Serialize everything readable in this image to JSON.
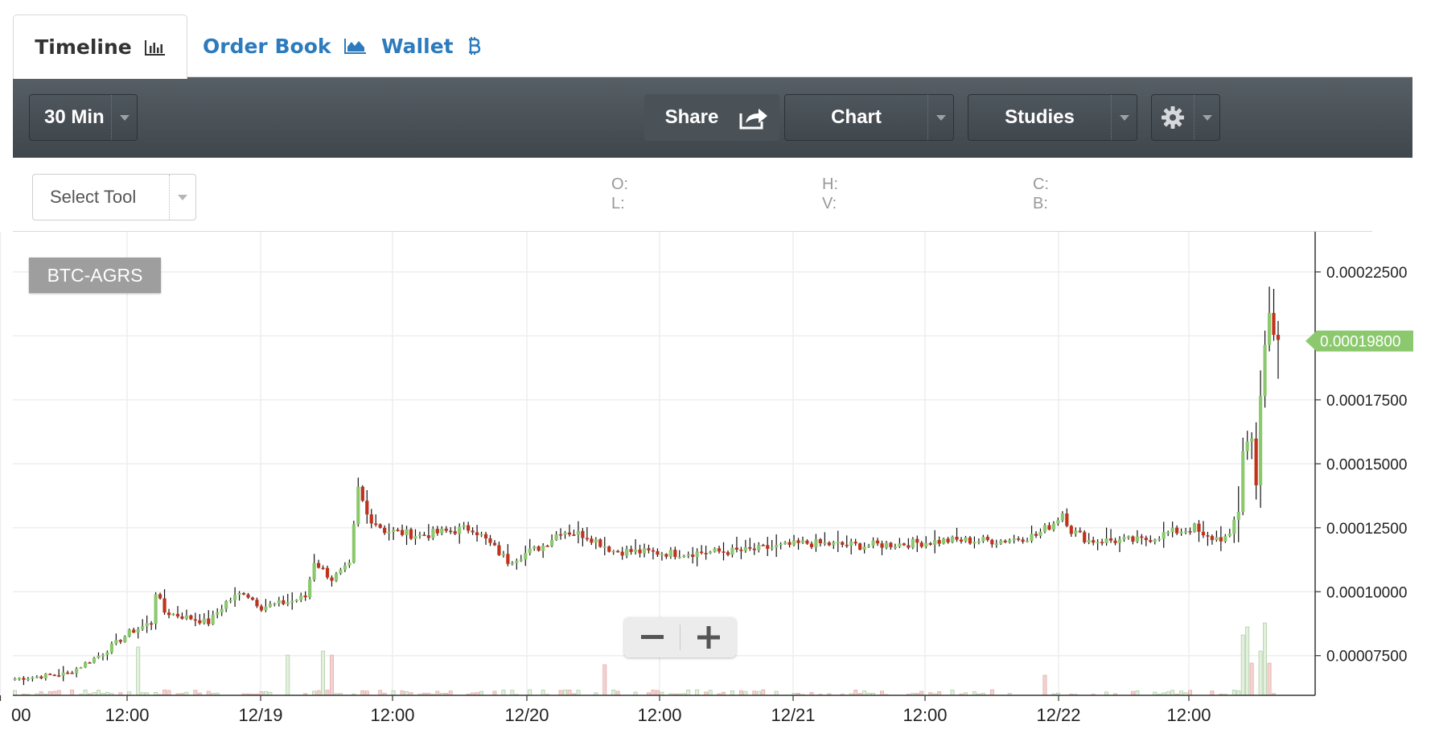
{
  "tabs": [
    {
      "label": "Timeline",
      "icon": "bar-chart-icon",
      "active": true
    },
    {
      "label": "Order Book",
      "icon": "area-chart-icon",
      "active": false
    },
    {
      "label": "Wallet",
      "icon": "bitcoin-icon",
      "active": false
    }
  ],
  "toolbar": {
    "interval": "30 Min",
    "share": "Share",
    "chart": "Chart",
    "studies": "Studies",
    "settings_icon": "gear-icon"
  },
  "info": {
    "select_tool": "Select Tool",
    "o": "O:",
    "l": "L:",
    "h": "H:",
    "v": "V:",
    "c": "C:",
    "b": "B:"
  },
  "symbol": "BTC-AGRS",
  "zoom": {
    "out": "−",
    "in": "+"
  },
  "colors": {
    "up": "#8cc96e",
    "down": "#c0321c",
    "vol_up": "#e2f0dc",
    "vol_down": "#f3d2d0",
    "price_tag": "#8cc96e",
    "toolbar": "#4a5258",
    "link": "#2d7bbd"
  },
  "chart_data": {
    "type": "candlestick",
    "symbol": "BTC-AGRS",
    "interval": "30 Min",
    "x_tick_labels": [
      "00",
      "12:00",
      "12/19",
      "12:00",
      "12/20",
      "12:00",
      "12/21",
      "12:00",
      "12/22",
      "12:00"
    ],
    "y_tick_labels": [
      "0.00022500",
      "0.00017500",
      "0.00015000",
      "0.00012500",
      "0.00010000",
      "0.00007500"
    ],
    "ylim": [
      5.95e-05,
      0.0002407
    ],
    "last_price": "0.00019800",
    "grid": true,
    "anchors": [
      [
        0,
        6.6e-05
      ],
      [
        12,
        6.8e-05
      ],
      [
        20,
        7.6e-05
      ],
      [
        26,
        8.4e-05
      ],
      [
        31,
        8.8e-05
      ],
      [
        32,
        0.0001
      ],
      [
        34,
        9.2e-05
      ],
      [
        44,
        8.8e-05
      ],
      [
        48,
        9.6e-05
      ],
      [
        52,
        0.0001
      ],
      [
        56,
        9.4e-05
      ],
      [
        62,
        9.6e-05
      ],
      [
        66,
        9.8e-05
      ],
      [
        68,
        0.000112
      ],
      [
        72,
        0.000105
      ],
      [
        76,
        0.00011
      ],
      [
        78,
        0.00014
      ],
      [
        80,
        0.00013
      ],
      [
        84,
        0.000124
      ],
      [
        92,
        0.000122
      ],
      [
        104,
        0.000125
      ],
      [
        112,
        0.000112
      ],
      [
        120,
        0.000118
      ],
      [
        124,
        0.000124
      ],
      [
        130,
        0.000122
      ],
      [
        136,
        0.000116
      ],
      [
        150,
        0.000115
      ],
      [
        166,
        0.000116
      ],
      [
        180,
        0.000119
      ],
      [
        192,
        0.000118
      ],
      [
        204,
        0.000119
      ],
      [
        212,
        0.00012
      ],
      [
        224,
        0.00012
      ],
      [
        232,
        0.000122
      ],
      [
        236,
        0.000127
      ],
      [
        238,
        0.000131
      ],
      [
        240,
        0.000124
      ],
      [
        244,
        0.00012
      ],
      [
        256,
        0.00012
      ],
      [
        262,
        0.000123
      ],
      [
        268,
        0.000125
      ],
      [
        270,
        0.000121
      ],
      [
        276,
        0.000121
      ],
      [
        278,
        0.000133
      ],
      [
        279,
        0.000157
      ],
      [
        281,
        0.000159
      ],
      [
        282,
        0.000146
      ],
      [
        283,
        0.000178
      ],
      [
        285,
        0.000205
      ],
      [
        286,
        0.0002
      ],
      [
        287,
        0.000198
      ]
    ],
    "volume_spikes": [
      [
        0,
        6,
        true
      ],
      [
        28,
        60,
        true
      ],
      [
        62,
        50,
        true
      ],
      [
        70,
        55,
        true
      ],
      [
        72,
        50,
        false
      ],
      [
        134,
        38,
        false
      ],
      [
        234,
        25,
        false
      ],
      [
        279,
        75,
        true
      ],
      [
        280,
        85,
        true
      ],
      [
        281,
        40,
        false
      ],
      [
        283,
        55,
        true
      ],
      [
        284,
        90,
        true
      ],
      [
        285,
        40,
        false
      ]
    ]
  }
}
